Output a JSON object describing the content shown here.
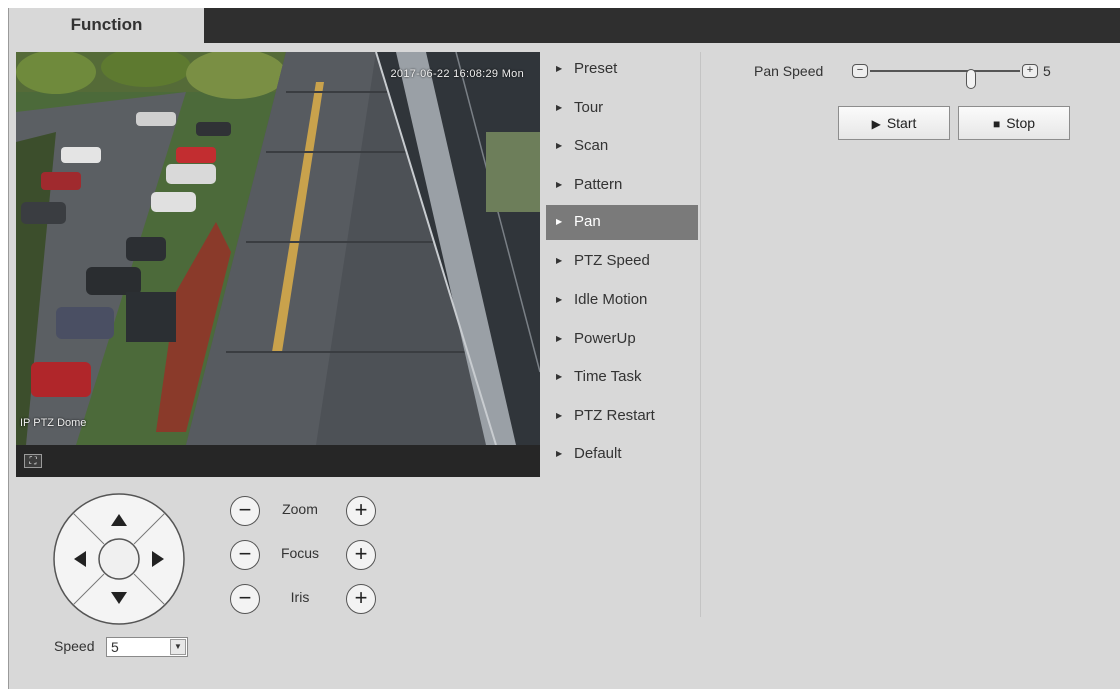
{
  "tab": {
    "label": "Function"
  },
  "video": {
    "timestamp": "2017-06-22 16:08:29 Mon",
    "channel": "IP PTZ Dome",
    "fullscreen_icon": "fullscreen-icon"
  },
  "controls": {
    "zoom_label": "Zoom",
    "focus_label": "Focus",
    "iris_label": "Iris",
    "minus": "−",
    "plus": "+",
    "speed_label": "Speed",
    "speed_value": "5",
    "speed_arrow": "▼"
  },
  "menu": {
    "items": [
      {
        "label": "Preset"
      },
      {
        "label": "Tour"
      },
      {
        "label": "Scan"
      },
      {
        "label": "Pattern"
      },
      {
        "label": "Pan"
      },
      {
        "label": "PTZ Speed"
      },
      {
        "label": "Idle Motion"
      },
      {
        "label": "PowerUp"
      },
      {
        "label": "Time Task"
      },
      {
        "label": "PTZ Restart"
      },
      {
        "label": "Default"
      }
    ],
    "active": "Pan",
    "arrow": "▶"
  },
  "pan": {
    "speed_label": "Pan Speed",
    "speed_value": "5",
    "minus": "−",
    "plus": "+",
    "start_label": "Start",
    "stop_label": "Stop",
    "start_icon": "▶",
    "stop_icon": "■"
  },
  "colors": {
    "topbar": "#2f2f2f",
    "panel": "#d8d8d8",
    "menu_active": "#7a7a7a"
  }
}
